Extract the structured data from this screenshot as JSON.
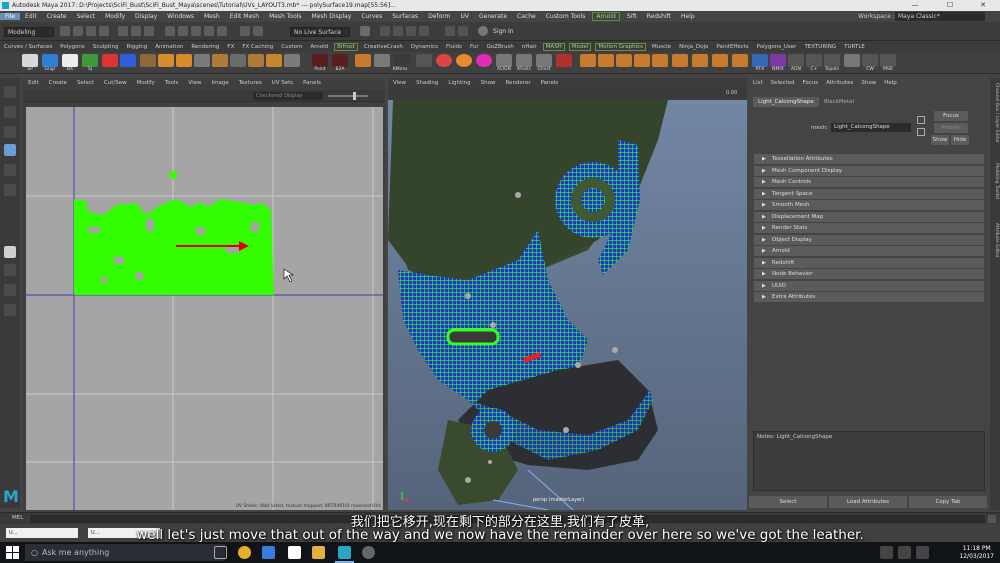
{
  "titlebar": {
    "text": "Autodesk Maya 2017: D:\\Projects\\SciFi_Bust\\SciFi_Bust_Maya\\scenes\\Tutorial\\UVs_LAYOUT3.mb*  ---  polySurface19.map[55:56]...",
    "minimize": "—",
    "maximize": "☐",
    "close": "✕"
  },
  "menubar": [
    "File",
    "Edit",
    "Create",
    "Select",
    "Modify",
    "Display",
    "Windows",
    "Mesh",
    "Edit Mesh",
    "Mesh Tools",
    "Mesh Display",
    "Curves",
    "Surfaces",
    "Deform",
    "UV",
    "Generate",
    "Cache",
    "Custom Tools",
    "Arnold",
    "Sift",
    "Redshift",
    "Help"
  ],
  "workspace": {
    "label": "Workspace :",
    "value": "Maya Classic*"
  },
  "statusline": {
    "mode": "Modeling",
    "live": "No Live Surface",
    "signin": "Sign In"
  },
  "shelftabs": [
    "Curves / Surfaces",
    "Polygons",
    "Sculpting",
    "Rigging",
    "Animation",
    "Rendering",
    "FX",
    "FX Caching",
    "Custom",
    "Arnold",
    "Bifrost",
    "CreativeCrash",
    "Dynamics",
    "Fluids",
    "Fur",
    "GoZBrush",
    "nHair",
    "MASH",
    "Model",
    "Motion Graphics",
    "Muscle",
    "Ninja_Dojo",
    "PaintEffects",
    "Polygons_User",
    "TEXTURING",
    "TURTLE"
  ],
  "shelf": {
    "left_labels": [
      "SP",
      "Gngr",
      "BX",
      "SJ"
    ],
    "mid_labels": [
      "Point",
      "B2A",
      "KMirro"
    ],
    "right_labels": [
      "ALIGN",
      "Khalis",
      "Ghost",
      "PFX",
      "NMIX",
      "ADN",
      "C+",
      "TopoIn",
      "CW",
      "MSR"
    ]
  },
  "uv_editor": {
    "menu": [
      "Edit",
      "Create",
      "Select",
      "Cut/Sew",
      "Modify",
      "Tools",
      "View",
      "Image",
      "Textures",
      "UV Sets",
      "Panels"
    ],
    "field": "Checkered Display",
    "info": "UV Shells: (Not listed, texture mapped, 86TR4910) reversed UVs"
  },
  "viewport": {
    "menu": [
      "View",
      "Shading",
      "Lighting",
      "Show",
      "Renderer",
      "Panels"
    ],
    "camera_label": "persp (masterLayer)",
    "value": "0.00"
  },
  "attribute_editor": {
    "menu": [
      "List",
      "Selected",
      "Focus",
      "Attributes",
      "Show",
      "Help"
    ],
    "tab_active": "Light_CalcongShape",
    "tab_other": "BlackMetal",
    "mesh_label": "mesh:",
    "mesh_value": "Light_CalcongShape",
    "btn_focus": "Focus",
    "btn_presets": "Presets",
    "btn_show": "Show",
    "btn_hide": "Hide",
    "sections": [
      "Tessellation Attributes",
      "Mesh Component Display",
      "Mesh Controls",
      "Tangent Space",
      "Smooth Mesh",
      "Displacement Map",
      "Render Stats",
      "Object Display",
      "Arnold",
      "Redshift",
      "Node Behavior",
      "UUID",
      "Extra Attributes"
    ],
    "notes_label": "Notes: Light_CalcongShape",
    "bottom_buttons": [
      "Select",
      "Load Attributes",
      "Copy Tab"
    ]
  },
  "side_tabs": [
    "Channel Box / Layer Editor",
    "Modeling Toolkit",
    "Attribute Editor"
  ],
  "cmdline": {
    "label": "MEL"
  },
  "minimized_windows": [
    "U...",
    "U..."
  ],
  "subtitles": {
    "cn": "我们把它移开,现在剩下的部分在这里,我们有了皮革,",
    "en": "well let's just move that out of the way and we now have the remainder over here so we've got the leather."
  },
  "taskbar": {
    "search_placeholder": "Ask me anything",
    "time": "11:18 PM",
    "date": "12/03/2017"
  },
  "colors": {
    "uv_shell": "#33ff00",
    "wire_green": "#33ff22",
    "wire_blue": "#2233cc",
    "arrow_red": "#e00000",
    "maya_accent": "#28a7c9"
  }
}
